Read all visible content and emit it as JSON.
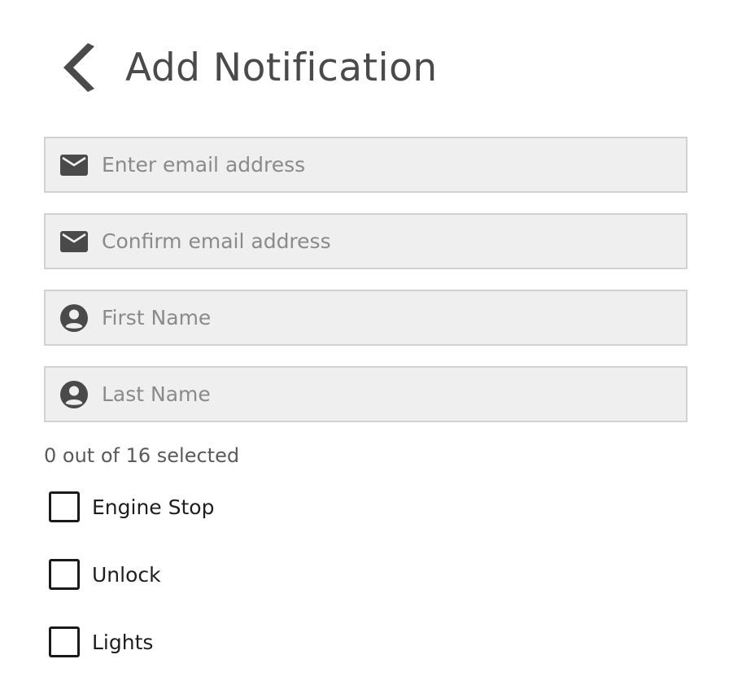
{
  "header": {
    "title": "Add Notification",
    "back_icon": "chevron-left-icon"
  },
  "form": {
    "email": {
      "placeholder": "Enter email address",
      "value": "",
      "icon": "envelope-icon"
    },
    "confirm_email": {
      "placeholder": "Confirm email address",
      "value": "",
      "icon": "envelope-icon"
    },
    "first_name": {
      "placeholder": "First Name",
      "value": "",
      "icon": "account-circle-icon"
    },
    "last_name": {
      "placeholder": "Last Name",
      "value": "",
      "icon": "account-circle-icon"
    }
  },
  "selection": {
    "summary": "0 out of 16 selected",
    "selected": 0,
    "total": 16
  },
  "options": [
    {
      "label": "Engine Stop",
      "checked": false
    },
    {
      "label": "Unlock",
      "checked": false
    },
    {
      "label": "Lights",
      "checked": false
    }
  ],
  "colors": {
    "field_background": "#efefef",
    "field_border": "#d2d2d2",
    "icon": "#4a4a4a",
    "placeholder": "#8a8a8a",
    "checkbox_border": "#1a1a1a"
  }
}
